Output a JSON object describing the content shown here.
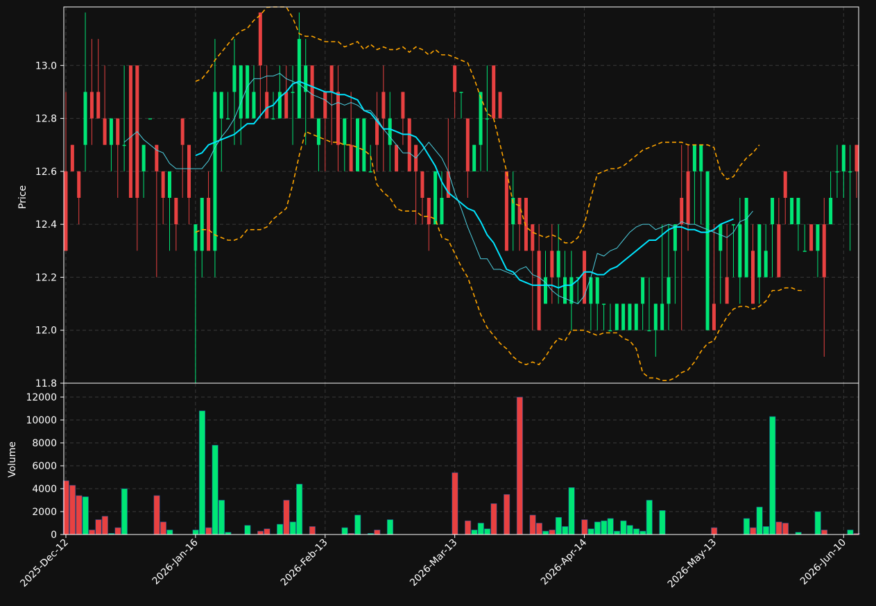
{
  "colors": {
    "background": "#111111",
    "up": "#00e676",
    "down": "#e84141",
    "grid": "#3a3a3a",
    "axis": "#ffffff",
    "ma_fast": "#00e5ff",
    "ma_slow": "#4dd0e1",
    "bollinger": "#ffa500"
  },
  "chart_data": {
    "type": "candlestick",
    "price_panel": {
      "ylabel": "Price",
      "ylim": [
        11.8,
        13.2
      ],
      "yticks": [
        "11.8",
        "12.0",
        "12.2",
        "12.4",
        "12.6",
        "12.8",
        "13.0"
      ],
      "grid": true
    },
    "volume_panel": {
      "ylabel": "Volume",
      "ylim": [
        0,
        12000
      ],
      "yticks": [
        "0",
        "2000",
        "4000",
        "6000",
        "8000",
        "10000",
        "12000"
      ],
      "grid": true
    },
    "x_ticks": [
      {
        "index": 0,
        "label": "2025-Dec-12"
      },
      {
        "index": 20,
        "label": "2026-Jan-16"
      },
      {
        "index": 40,
        "label": "2026-Feb-13"
      },
      {
        "index": 60,
        "label": "2026-Mar-13"
      },
      {
        "index": 80,
        "label": "2026-Apr-14"
      },
      {
        "index": 100,
        "label": "2026-May-13"
      },
      {
        "index": 120,
        "label": "2026-Jun-10"
      }
    ],
    "candles": {
      "open": [
        12.6,
        12.7,
        12.6,
        12.7,
        12.9,
        12.9,
        12.8,
        12.7,
        12.8,
        12.7,
        13.0,
        13.0,
        12.6,
        12.8,
        12.7,
        12.6,
        12.5,
        12.5,
        12.8,
        12.7,
        12.3,
        12.3,
        12.5,
        12.3,
        12.8,
        12.8,
        12.9,
        12.8,
        12.8,
        12.8,
        13.2,
        12.9,
        12.8,
        12.8,
        12.9,
        12.9,
        12.8,
        12.9,
        13.0,
        12.7,
        12.9,
        13.0,
        12.9,
        12.7,
        12.7,
        12.6,
        12.6,
        12.6,
        12.8,
        12.9,
        12.7,
        12.7,
        12.9,
        12.8,
        12.7,
        12.6,
        12.5,
        12.4,
        12.4,
        12.6,
        13.0,
        12.9,
        12.8,
        12.6,
        12.7,
        12.8,
        13.0,
        12.9,
        12.6,
        12.4,
        12.5,
        12.5,
        12.4,
        12.3,
        12.1,
        12.3,
        12.2,
        12.1,
        12.1,
        12.2,
        12.3,
        12.1,
        12.1,
        12.1,
        12.0,
        12.0,
        12.0,
        12.0,
        12.0,
        12.1,
        12.0,
        12.0,
        12.0,
        12.1,
        12.3,
        12.5,
        12.6,
        12.6,
        12.6,
        12.0,
        12.1,
        12.3,
        12.2,
        12.4,
        12.2,
        12.2,
        12.3,
        12.2,
        12.2,
        12.4,
        12.4,
        12.6,
        12.4,
        12.4,
        12.3,
        12.4,
        12.3,
        12.4,
        12.4,
        12.6,
        12.6,
        12.6,
        12.7
      ],
      "high": [
        12.9,
        12.7,
        12.6,
        13.2,
        13.1,
        13.1,
        13.0,
        12.8,
        12.8,
        13.0,
        13.0,
        12.8,
        12.7,
        12.6,
        12.7,
        12.6,
        12.5,
        12.4,
        12.8,
        12.4,
        12.4,
        12.4,
        12.6,
        13.1,
        12.9,
        12.9,
        13.1,
        13.0,
        13.0,
        13.0,
        13.2,
        13.0,
        12.9,
        13.0,
        13.0,
        13.0,
        13.2,
        13.1,
        13.0,
        12.8,
        12.9,
        13.0,
        13.0,
        12.8,
        12.9,
        12.8,
        12.8,
        12.7,
        12.9,
        13.0,
        12.9,
        12.7,
        12.9,
        12.8,
        12.7,
        12.6,
        12.5,
        12.6,
        12.6,
        12.8,
        13.0,
        12.9,
        12.8,
        12.7,
        12.9,
        13.0,
        13.0,
        12.9,
        12.6,
        12.6,
        12.5,
        12.5,
        12.4,
        12.4,
        12.3,
        12.4,
        12.4,
        12.3,
        12.3,
        12.2,
        12.3,
        12.2,
        12.2,
        12.1,
        12.1,
        12.1,
        12.1,
        12.1,
        12.1,
        12.1,
        12.2,
        12.1,
        12.4,
        12.4,
        12.4,
        12.7,
        12.7,
        12.7,
        12.7,
        12.6,
        12.4,
        12.4,
        12.4,
        12.4,
        12.5,
        12.2,
        12.4,
        12.4,
        12.4,
        12.5,
        12.5,
        12.6,
        12.4,
        12.4,
        12.4,
        12.4,
        12.3,
        12.5,
        12.6,
        12.7,
        12.7,
        12.7,
        12.7
      ],
      "low": [
        12.3,
        12.6,
        12.4,
        12.6,
        12.7,
        12.8,
        12.7,
        12.6,
        12.5,
        12.6,
        12.5,
        12.3,
        12.5,
        12.6,
        12.2,
        12.4,
        12.3,
        12.3,
        12.5,
        12.5,
        11.8,
        12.2,
        12.4,
        12.2,
        12.6,
        12.8,
        12.7,
        12.7,
        12.8,
        12.8,
        12.8,
        12.8,
        12.8,
        12.8,
        12.8,
        12.7,
        12.8,
        12.7,
        12.8,
        12.6,
        12.6,
        12.7,
        12.6,
        12.6,
        12.6,
        12.6,
        12.6,
        12.6,
        12.6,
        12.6,
        12.6,
        12.6,
        12.7,
        12.6,
        12.4,
        12.4,
        12.3,
        12.4,
        12.4,
        12.5,
        12.8,
        12.8,
        12.5,
        12.6,
        12.6,
        12.6,
        12.8,
        12.8,
        12.3,
        12.3,
        12.3,
        12.3,
        12.0,
        12.0,
        12.1,
        12.1,
        12.1,
        12.1,
        12.0,
        12.1,
        12.1,
        12.0,
        12.0,
        12.0,
        12.0,
        12.0,
        12.0,
        12.0,
        12.0,
        12.0,
        12.0,
        11.9,
        12.0,
        12.0,
        12.1,
        12.0,
        12.3,
        12.4,
        12.4,
        12.0,
        12.1,
        12.1,
        12.2,
        12.2,
        12.1,
        12.2,
        12.2,
        12.1,
        12.2,
        12.2,
        12.2,
        12.4,
        12.4,
        12.3,
        12.3,
        12.3,
        12.2,
        11.9,
        12.4,
        12.5,
        12.5,
        12.3,
        12.5
      ],
      "close": [
        12.3,
        12.6,
        12.5,
        12.9,
        12.8,
        12.8,
        12.7,
        12.8,
        12.7,
        12.7,
        12.5,
        12.5,
        12.7,
        12.8,
        12.6,
        12.5,
        12.6,
        12.4,
        12.7,
        12.5,
        12.4,
        12.5,
        12.3,
        12.9,
        12.9,
        12.8,
        13.0,
        13.0,
        13.0,
        12.9,
        13.0,
        12.8,
        12.8,
        12.9,
        12.8,
        12.9,
        13.1,
        13.0,
        12.8,
        12.8,
        12.8,
        12.9,
        12.7,
        12.8,
        12.6,
        12.8,
        12.8,
        12.6,
        12.7,
        12.8,
        12.8,
        12.6,
        12.8,
        12.6,
        12.6,
        12.5,
        12.4,
        12.6,
        12.5,
        12.5,
        12.9,
        12.9,
        12.6,
        12.7,
        12.9,
        12.8,
        12.8,
        12.8,
        12.3,
        12.5,
        12.4,
        12.3,
        12.3,
        12.0,
        12.2,
        12.2,
        12.3,
        12.2,
        12.2,
        12.2,
        12.1,
        12.2,
        12.2,
        12.1,
        12.0,
        12.1,
        12.1,
        12.1,
        12.1,
        12.2,
        12.0,
        12.1,
        12.1,
        12.2,
        12.4,
        12.4,
        12.4,
        12.7,
        12.7,
        12.6,
        12.0,
        12.4,
        12.1,
        12.4,
        12.4,
        12.5,
        12.1,
        12.4,
        12.3,
        12.5,
        12.2,
        12.5,
        12.5,
        12.5,
        12.3,
        12.3,
        12.4,
        12.2,
        12.5,
        12.6,
        12.7,
        12.6,
        12.6
      ],
      "volume": [
        4700,
        4300,
        3400,
        3300,
        400,
        1300,
        1600,
        100,
        600,
        4000,
        0,
        0,
        0,
        0,
        3400,
        1100,
        400,
        0,
        0,
        0,
        400,
        10800,
        600,
        7800,
        3000,
        200,
        0,
        0,
        800,
        0,
        300,
        500,
        0,
        900,
        3000,
        1100,
        4400,
        0,
        700,
        0,
        0,
        0,
        0,
        600,
        100,
        1700,
        0,
        100,
        400,
        0,
        1300,
        0,
        0,
        0,
        0,
        0,
        0,
        0,
        0,
        0,
        5400,
        0,
        1200,
        400,
        1000,
        500,
        2700,
        0,
        3500,
        0,
        12000,
        0,
        1700,
        1000,
        300,
        400,
        1500,
        700,
        4100,
        0,
        1300,
        500,
        1100,
        1200,
        1400,
        300,
        1200,
        800,
        500,
        300,
        3000,
        0,
        2100,
        0,
        0,
        0,
        0,
        0,
        0,
        0,
        600,
        0,
        0,
        0,
        0,
        1400,
        600,
        2400,
        700,
        10300,
        1100,
        1000,
        0,
        200,
        0,
        0,
        2000,
        400,
        0,
        0,
        0,
        400,
        100,
        200,
        0,
        700,
        0,
        0,
        0,
        0,
        1300,
        400,
        1200,
        900,
        600
      ]
    },
    "series": [
      {
        "values": [
          null,
          null,
          null,
          null,
          null,
          null,
          null,
          null,
          null,
          null,
          null,
          null,
          null,
          null,
          null,
          null,
          null,
          null,
          null,
          null,
          12.66,
          12.67,
          12.7,
          12.71,
          12.72,
          12.73,
          12.74,
          12.76,
          12.78,
          12.78,
          12.81,
          12.84,
          12.85,
          12.88,
          12.9,
          12.93,
          12.94,
          12.93,
          12.92,
          12.91,
          12.9,
          12.9,
          12.89,
          12.89,
          12.88,
          12.87,
          12.83,
          12.82,
          12.79,
          12.76,
          12.76,
          12.75,
          12.74,
          12.74,
          12.73,
          12.7,
          12.66,
          12.62,
          12.56,
          12.52,
          12.5,
          12.48,
          12.46,
          12.45,
          12.41,
          12.36,
          12.33,
          12.28,
          12.23,
          12.22,
          12.19,
          12.18,
          12.17,
          12.17,
          12.17,
          12.17,
          12.16,
          12.17,
          12.17,
          12.19,
          12.22,
          12.22,
          12.21,
          12.21,
          12.23,
          12.24,
          12.26,
          12.28,
          12.3,
          12.32,
          12.34,
          12.34,
          12.36,
          12.38,
          12.39,
          12.39,
          12.38,
          12.38,
          12.37,
          12.37,
          12.38,
          12.4,
          12.41,
          12.42
        ]
      },
      {
        "values": [
          null,
          null,
          null,
          null,
          null,
          null,
          null,
          null,
          null,
          12.71,
          12.73,
          12.75,
          12.72,
          12.7,
          12.68,
          12.67,
          12.63,
          12.61,
          12.61,
          12.61,
          12.61,
          12.61,
          12.64,
          12.69,
          12.73,
          12.76,
          12.8,
          12.86,
          12.92,
          12.95,
          12.95,
          12.96,
          12.96,
          12.97,
          12.95,
          12.94,
          12.93,
          12.91,
          12.89,
          12.88,
          12.87,
          12.85,
          12.86,
          12.85,
          12.86,
          12.85,
          12.83,
          12.83,
          12.8,
          12.76,
          12.73,
          12.7,
          12.67,
          12.67,
          12.65,
          12.68,
          12.71,
          12.68,
          12.65,
          12.6,
          12.52,
          12.46,
          12.39,
          12.33,
          12.27,
          12.27,
          12.23,
          12.23,
          12.22,
          12.21,
          12.23,
          12.24,
          12.21,
          12.2,
          12.18,
          12.15,
          12.13,
          12.12,
          12.11,
          12.1,
          12.13,
          12.2,
          12.29,
          12.28,
          12.3,
          12.31,
          12.34,
          12.37,
          12.39,
          12.4,
          12.4,
          12.38,
          12.39,
          12.4,
          12.39,
          12.41,
          12.4,
          12.4,
          12.39,
          12.38,
          12.37,
          12.36,
          12.35,
          12.37,
          12.41,
          12.42,
          12.45
        ]
      },
      {
        "values": [
          null,
          null,
          null,
          null,
          null,
          null,
          null,
          null,
          null,
          null,
          null,
          null,
          null,
          null,
          null,
          null,
          null,
          null,
          null,
          null,
          12.94,
          12.95,
          12.98,
          13.02,
          13.05,
          13.08,
          13.11,
          13.13,
          13.14,
          13.17,
          13.19,
          13.22,
          13.26,
          13.3,
          13.25,
          13.18,
          13.12,
          13.11,
          13.11,
          13.1,
          13.09,
          13.09,
          13.09,
          13.07,
          13.08,
          13.09,
          13.06,
          13.08,
          13.06,
          13.07,
          13.06,
          13.06,
          13.07,
          13.05,
          13.07,
          13.06,
          13.04,
          13.06,
          13.04,
          13.04,
          13.03,
          13.02,
          13.01,
          12.95,
          12.88,
          12.82,
          12.8,
          12.7,
          12.6,
          12.48,
          12.47,
          12.39,
          12.37,
          12.36,
          12.35,
          12.36,
          12.35,
          12.33,
          12.33,
          12.35,
          12.4,
          12.5,
          12.59,
          12.6,
          12.61,
          12.61,
          12.62,
          12.64,
          12.66,
          12.68,
          12.69,
          12.7,
          12.71,
          12.71,
          12.71,
          12.71,
          12.7,
          12.7,
          12.7,
          12.7,
          12.69,
          12.6,
          12.57,
          12.58,
          12.62,
          12.65,
          12.67,
          12.7
        ]
      },
      {
        "values": [
          null,
          null,
          null,
          null,
          null,
          null,
          null,
          null,
          null,
          null,
          null,
          null,
          null,
          null,
          null,
          null,
          null,
          null,
          null,
          null,
          12.37,
          12.38,
          12.38,
          12.36,
          12.35,
          12.34,
          12.34,
          12.35,
          12.38,
          12.38,
          12.38,
          12.39,
          12.42,
          12.44,
          12.46,
          12.55,
          12.66,
          12.75,
          12.74,
          12.73,
          12.72,
          12.71,
          12.71,
          12.7,
          12.7,
          12.69,
          12.68,
          12.66,
          12.55,
          12.52,
          12.5,
          12.46,
          12.45,
          12.45,
          12.45,
          12.43,
          12.43,
          12.42,
          12.35,
          12.34,
          12.29,
          12.24,
          12.2,
          12.13,
          12.06,
          12.01,
          11.98,
          11.95,
          11.93,
          11.9,
          11.88,
          11.87,
          11.88,
          11.87,
          11.9,
          11.94,
          11.97,
          11.96,
          12.0,
          12.0,
          12.0,
          11.99,
          11.98,
          11.99,
          11.99,
          11.99,
          11.97,
          11.96,
          11.93,
          11.84,
          11.82,
          11.82,
          11.81,
          11.81,
          11.82,
          11.84,
          11.85,
          11.88,
          11.92,
          11.95,
          11.96,
          12.01,
          12.05,
          12.08,
          12.09,
          12.09,
          12.08,
          12.09,
          12.11,
          12.15,
          12.15,
          12.16,
          12.16,
          12.15,
          12.15
        ]
      }
    ]
  }
}
